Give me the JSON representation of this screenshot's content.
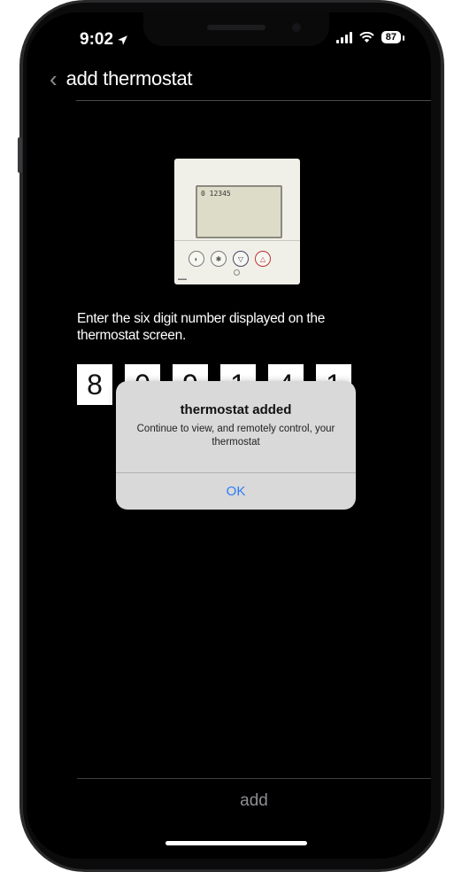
{
  "status_bar": {
    "time": "9:02",
    "location_icon": "location-arrow-icon",
    "battery_level": "87"
  },
  "nav": {
    "back_icon": "chevron-left-icon",
    "title": "add thermostat"
  },
  "device": {
    "lcd_text": "0 12345"
  },
  "instructions": "Enter the six digit number displayed on the thermostat screen.",
  "code_digits": [
    "8",
    "0",
    "9",
    "1",
    "4",
    "1"
  ],
  "dialog": {
    "title": "thermostat added",
    "message": "Continue to view, and remotely control, your thermostat",
    "ok_label": "OK"
  },
  "footer": {
    "add_label": "add"
  },
  "colors": {
    "background": "#000000",
    "dialog_bg": "#d9d9d9",
    "accent": "#2f7cf6",
    "muted": "#8e8e93"
  }
}
